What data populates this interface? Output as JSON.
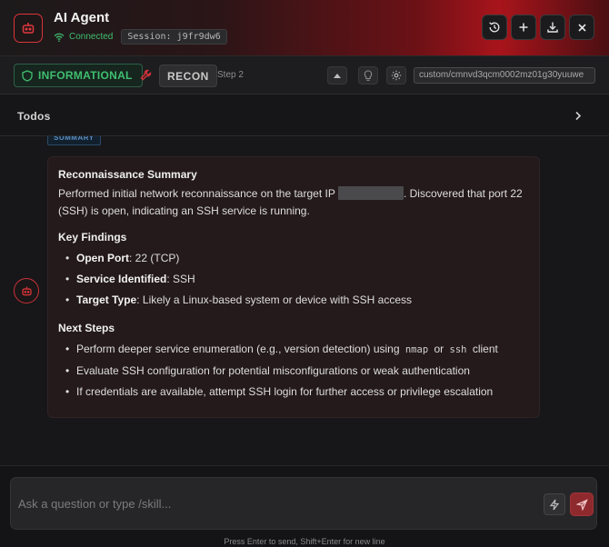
{
  "header": {
    "title": "AI Agent",
    "connection_status": "Connected",
    "session_label": "Session: j9fr9dw6",
    "buttons": [
      "history-icon",
      "plus-icon",
      "download-icon",
      "close-icon"
    ]
  },
  "status_bar": {
    "severity": "INFORMATIONAL",
    "phase": "RECON",
    "step": "Step 2",
    "model": "custom/cmnvd3qcm0002mz01g30yuuwe"
  },
  "todos": {
    "label": "Todos"
  },
  "message": {
    "tag": "SUMMARY",
    "heading": "Reconnaissance Summary",
    "intro_before": "Performed initial network reconnaissance on the target IP",
    "intro_after": ". Discovered that port 22 (SSH) is open, indicating an SSH service is running.",
    "key_findings_heading": "Key Findings",
    "findings": [
      {
        "label": "Open Port",
        "value": ": 22 (TCP)"
      },
      {
        "label": "Service Identified",
        "value": ": SSH"
      },
      {
        "label": "Target Type",
        "value": ": Likely a Linux-based system or device with SSH access"
      }
    ],
    "next_steps_heading": "Next Steps",
    "next_step_1_before": "Perform deeper service enumeration (e.g., version detection) using",
    "next_step_1_code_a": "nmap",
    "next_step_1_mid": "or",
    "next_step_1_code_b": "ssh",
    "next_step_1_after": "client",
    "next_step_2": "Evaluate SSH configuration for potential misconfigurations or weak authentication",
    "next_step_3": "If credentials are available, attempt SSH login for further access or privilege escalation"
  },
  "input": {
    "placeholder": "Ask a question or type /skill...",
    "hint": "Press Enter to send, Shift+Enter for new line"
  },
  "colors": {
    "accent_red": "#c83238",
    "status_green": "#3fbf6f",
    "summary_blue": "#5b8fc4"
  }
}
